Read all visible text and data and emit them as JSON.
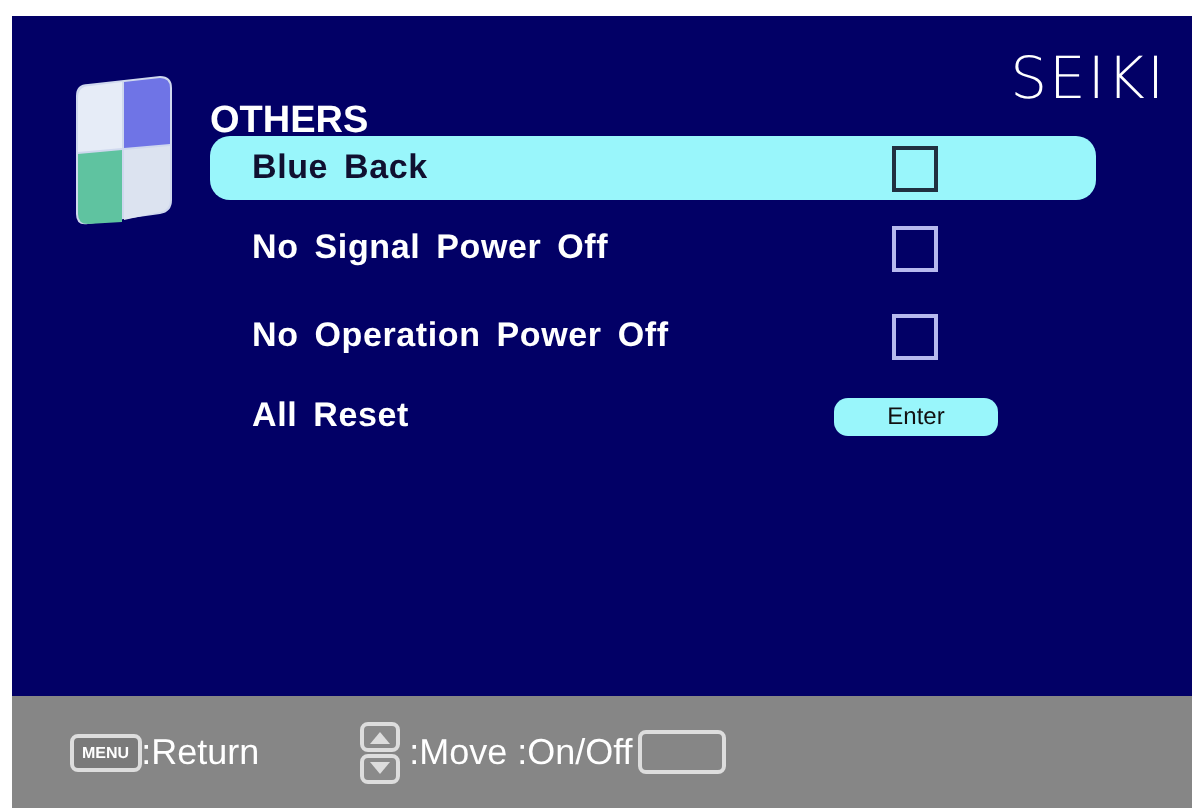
{
  "brand": "SEIKI",
  "menu_title": "OTHERS",
  "items": [
    {
      "label": "Blue Back",
      "kind": "checkbox",
      "checked": false,
      "selected": true
    },
    {
      "label": "No Signal Power Off",
      "kind": "checkbox",
      "checked": false,
      "selected": false
    },
    {
      "label": "No Operation Power Off",
      "kind": "checkbox",
      "checked": false,
      "selected": false
    },
    {
      "label": "All Reset",
      "kind": "button",
      "button_label": "Enter",
      "selected": false
    }
  ],
  "footer": {
    "menu_key": "MENU",
    "return_hint": ":Return",
    "move_hint": ":Move :On/Off"
  }
}
